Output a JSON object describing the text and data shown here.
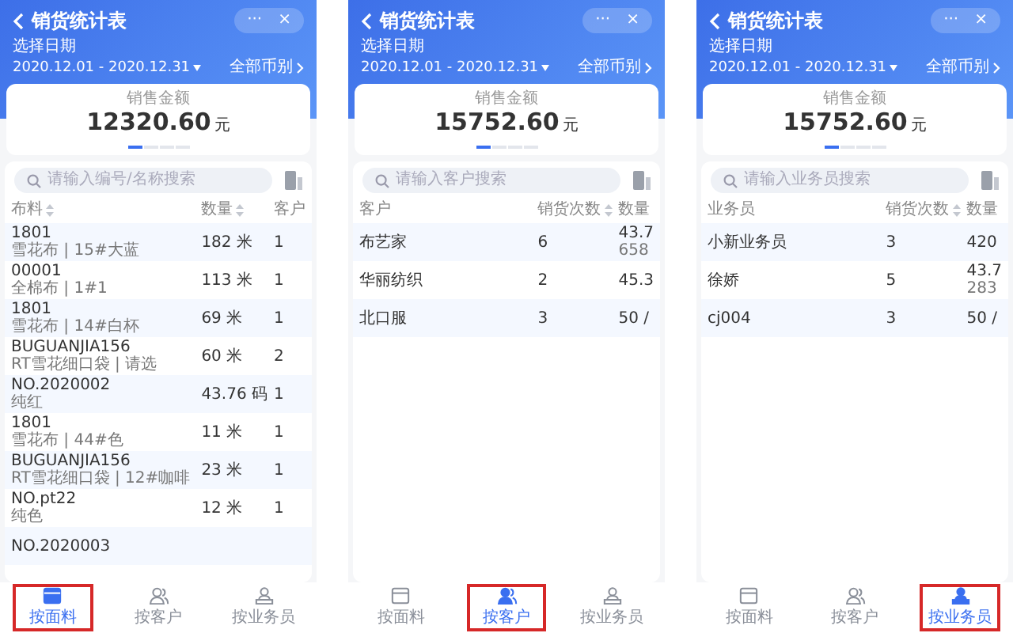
{
  "screens": [
    {
      "title": "销货统计表",
      "menu": "···",
      "close": "×",
      "date_label": "选择日期",
      "date_range": "2020.12.01 - 2020.12.31",
      "currency_filter": "全部币别",
      "summary": {
        "label": "销售金额",
        "amount": "12320.60",
        "unit": "元"
      },
      "pager": [
        {
          "selected": true
        },
        {
          "selected": false
        },
        {
          "selected": false
        },
        {
          "selected": false
        }
      ],
      "search": {
        "placeholder": "请输入编号/名称搜索"
      },
      "columns": [
        {
          "label": "布料",
          "sortable": true
        },
        {
          "label": "数量",
          "sortable": true
        },
        {
          "label": "客户",
          "sortable": false
        }
      ],
      "rows": [
        {
          "cells": [
            {
              "text": "1801",
              "sub": "雪花布 | 15#大蓝"
            },
            {
              "text": "182 米"
            },
            {
              "text": "1"
            }
          ]
        },
        {
          "cells": [
            {
              "text": "00001",
              "sub": "全棉布 | 1#1"
            },
            {
              "text": "113 米"
            },
            {
              "text": "1"
            }
          ]
        },
        {
          "cells": [
            {
              "text": "1801",
              "sub": "雪花布 | 14#白杯"
            },
            {
              "text": "69 米"
            },
            {
              "text": "1"
            }
          ]
        },
        {
          "cells": [
            {
              "text": "BUGUANJIA156",
              "sub": "RT雪花细口袋 | 请选"
            },
            {
              "text": "60 米"
            },
            {
              "text": "2"
            }
          ]
        },
        {
          "cells": [
            {
              "text": "NO.2020002",
              "sub": "纯红"
            },
            {
              "text": "43.76 码"
            },
            {
              "text": "1"
            }
          ]
        },
        {
          "cells": [
            {
              "text": "1801",
              "sub": "雪花布 | 44#色"
            },
            {
              "text": "11 米"
            },
            {
              "text": "1"
            }
          ]
        },
        {
          "cells": [
            {
              "text": "BUGUANJIA156",
              "sub": "RT雪花细口袋 | 12#咖啡"
            },
            {
              "text": "23 米"
            },
            {
              "text": "1"
            }
          ]
        },
        {
          "cells": [
            {
              "text": "NO.pt22",
              "sub": "纯色"
            },
            {
              "text": "12 米"
            },
            {
              "text": "1"
            }
          ]
        },
        {
          "cells": [
            {
              "text": "NO.2020003"
            }
          ]
        }
      ],
      "tabs": [
        {
          "label": "按面料",
          "kind": "box",
          "selected": true
        },
        {
          "label": "按客户",
          "kind": "person",
          "selected": false
        },
        {
          "label": "按业务员",
          "kind": "staff",
          "selected": false
        }
      ]
    },
    {
      "title": "销货统计表",
      "menu": "···",
      "close": "×",
      "date_label": "选择日期",
      "date_range": "2020.12.01 - 2020.12.31",
      "currency_filter": "全部币别",
      "summary": {
        "label": "销售金额",
        "amount": "15752.60",
        "unit": "元"
      },
      "pager": [
        {
          "selected": true
        },
        {
          "selected": false
        },
        {
          "selected": false
        },
        {
          "selected": false
        }
      ],
      "search": {
        "placeholder": "请输入客户搜索"
      },
      "columns": [
        {
          "label": "客户",
          "sortable": false
        },
        {
          "label": "销货次数",
          "sortable": true
        },
        {
          "label": "数量",
          "sortable": false
        }
      ],
      "rows": [
        {
          "cells": [
            {
              "text": "布艺家"
            },
            {
              "text": "6"
            },
            {
              "text": "43.7",
              "sub": "658"
            }
          ]
        },
        {
          "cells": [
            {
              "text": "华丽纺织"
            },
            {
              "text": "2"
            },
            {
              "text": "45.3"
            }
          ]
        },
        {
          "cells": [
            {
              "text": "北口服"
            },
            {
              "text": "3"
            },
            {
              "text": "50 /"
            }
          ]
        }
      ],
      "tabs": [
        {
          "label": "按面料",
          "kind": "box",
          "selected": false
        },
        {
          "label": "按客户",
          "kind": "person",
          "selected": true
        },
        {
          "label": "按业务员",
          "kind": "staff",
          "selected": false
        }
      ]
    },
    {
      "title": "销货统计表",
      "menu": "···",
      "close": "×",
      "date_label": "选择日期",
      "date_range": "2020.12.01 - 2020.12.31",
      "currency_filter": "全部币别",
      "summary": {
        "label": "销售金额",
        "amount": "15752.60",
        "unit": "元"
      },
      "pager": [
        {
          "selected": true
        },
        {
          "selected": false
        },
        {
          "selected": false
        },
        {
          "selected": false
        }
      ],
      "search": {
        "placeholder": "请输入业务员搜索"
      },
      "columns": [
        {
          "label": "业务员",
          "sortable": false
        },
        {
          "label": "销货次数",
          "sortable": true
        },
        {
          "label": "数量",
          "sortable": false
        }
      ],
      "rows": [
        {
          "cells": [
            {
              "text": "小新业务员"
            },
            {
              "text": "3"
            },
            {
              "text": "420"
            }
          ]
        },
        {
          "cells": [
            {
              "text": "徐娇"
            },
            {
              "text": "5"
            },
            {
              "text": "43.7",
              "sub": "283"
            }
          ]
        },
        {
          "cells": [
            {
              "text": "cj004"
            },
            {
              "text": "3"
            },
            {
              "text": "50 /"
            }
          ]
        }
      ],
      "tabs": [
        {
          "label": "按面料",
          "kind": "box",
          "selected": false
        },
        {
          "label": "按客户",
          "kind": "person",
          "selected": false
        },
        {
          "label": "按业务员",
          "kind": "staff",
          "selected": true
        }
      ]
    }
  ]
}
